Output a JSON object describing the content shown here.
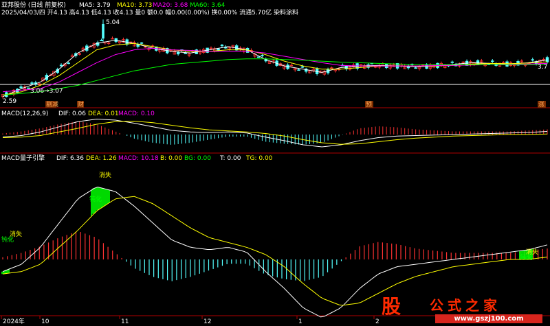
{
  "header": {
    "stock_name": "亚邦股份 (日线 前复权)",
    "ohlc_line": "2025/04/03/四 开4.13 高4.13 低4.13 收4.13 量0 额0.0 幅0.00(0.00%) 换0.00% 流通5.70亿 染料涂料",
    "ma5": "MA5: 3.79",
    "ma10": "MA10: 3.73",
    "ma20": "MA20: 3.68",
    "ma60": "MA60: 3.64"
  },
  "price_panel": {
    "high_label": "5.04",
    "low_label": "2.59",
    "mid_label": "3.06→3.07",
    "right_label": "3.7",
    "markers": [
      "剔减",
      "财",
      "预",
      "涨"
    ]
  },
  "macd_panel": {
    "title": "MACD(12,26,9)",
    "dif": "DIF: 0.06",
    "dea": "DEA: 0.01",
    "macd": "MACD: 0.10"
  },
  "pull_panel": {
    "title": "MACD量子引擎",
    "dif": "DIF: 6.36",
    "dea": "DEA: 1.26",
    "macd": "MACD: 10.18",
    "b": "B: 0.00",
    "bg": "BG: 0.00",
    "t": "T: 0.00",
    "tg": "TG: 0.00",
    "annotations": [
      "消失",
      "钝化",
      "钝化",
      "消失",
      "消失",
      "钝化"
    ]
  },
  "time_axis": [
    "2024年",
    "10",
    "11",
    "12",
    "1",
    "2"
  ],
  "colors": {
    "up": "#ff3232",
    "down": "#54ffff",
    "ma5": "#ffffff",
    "ma10": "#ffff00",
    "ma20": "#ff00ff",
    "ma60": "#00ff00",
    "dea": "#ffff00",
    "label_green": "#00ff00",
    "label_yellow": "#ffff00"
  },
  "logo": {
    "big": "股",
    "cn": "公式之家",
    "url": "www.gszj100.com"
  },
  "chart_data": {
    "type": "line",
    "title": "亚邦股份 (日线 前复权)",
    "price_range": [
      2.59,
      5.04
    ],
    "series": [
      {
        "name": "MA5",
        "values": [
          2.65,
          2.9,
          3.1,
          3.5,
          4.0,
          4.3,
          4.4,
          4.3,
          4.15,
          4.05,
          4.0,
          4.1,
          4.2,
          4.1,
          3.8,
          3.6,
          3.5,
          3.4,
          3.55,
          3.6,
          3.62,
          3.6,
          3.58,
          3.6,
          3.65,
          3.7,
          3.68,
          3.66,
          3.7,
          3.79
        ]
      },
      {
        "name": "MA10",
        "values": [
          2.7,
          2.8,
          3.0,
          3.3,
          3.7,
          4.1,
          4.25,
          4.3,
          4.2,
          4.1,
          4.05,
          4.05,
          4.1,
          4.1,
          3.95,
          3.75,
          3.6,
          3.5,
          3.5,
          3.55,
          3.6,
          3.6,
          3.6,
          3.6,
          3.62,
          3.66,
          3.68,
          3.67,
          3.69,
          3.73
        ]
      },
      {
        "name": "MA20",
        "values": [
          2.8,
          2.85,
          2.9,
          3.1,
          3.4,
          3.7,
          3.95,
          4.1,
          4.15,
          4.1,
          4.08,
          4.05,
          4.05,
          4.06,
          4.0,
          3.9,
          3.8,
          3.7,
          3.62,
          3.6,
          3.6,
          3.6,
          3.6,
          3.61,
          3.62,
          3.63,
          3.64,
          3.65,
          3.66,
          3.68
        ]
      },
      {
        "name": "MA60",
        "values": [
          2.7,
          2.75,
          2.8,
          2.9,
          3.0,
          3.15,
          3.3,
          3.45,
          3.55,
          3.65,
          3.7,
          3.75,
          3.8,
          3.82,
          3.82,
          3.8,
          3.78,
          3.75,
          3.72,
          3.7,
          3.68,
          3.66,
          3.65,
          3.64,
          3.64,
          3.64,
          3.64,
          3.64,
          3.64,
          3.64
        ]
      }
    ],
    "macd": {
      "dif": [
        -0.05,
        -0.02,
        0.05,
        0.15,
        0.25,
        0.3,
        0.28,
        0.22,
        0.15,
        0.08,
        0.05,
        0.04,
        0.05,
        0.03,
        -0.05,
        -0.12,
        -0.2,
        -0.24,
        -0.2,
        -0.12,
        -0.06,
        -0.03,
        -0.02,
        -0.01,
        0.0,
        0.01,
        0.02,
        0.03,
        0.04,
        0.06
      ],
      "dea": [
        -0.06,
        -0.05,
        -0.02,
        0.05,
        0.12,
        0.2,
        0.25,
        0.26,
        0.23,
        0.18,
        0.13,
        0.09,
        0.07,
        0.05,
        0.02,
        -0.03,
        -0.1,
        -0.16,
        -0.19,
        -0.18,
        -0.14,
        -0.1,
        -0.07,
        -0.05,
        -0.03,
        -0.02,
        -0.01,
        0.0,
        0.0,
        0.01
      ],
      "hist": [
        0.02,
        0.06,
        0.12,
        0.2,
        0.26,
        0.2,
        0.06,
        -0.08,
        -0.16,
        -0.2,
        -0.16,
        -0.1,
        -0.04,
        -0.04,
        -0.14,
        -0.18,
        -0.2,
        -0.16,
        -0.02,
        0.12,
        0.16,
        0.14,
        0.1,
        0.08,
        0.06,
        0.06,
        0.06,
        0.06,
        0.08,
        0.1
      ]
    }
  }
}
